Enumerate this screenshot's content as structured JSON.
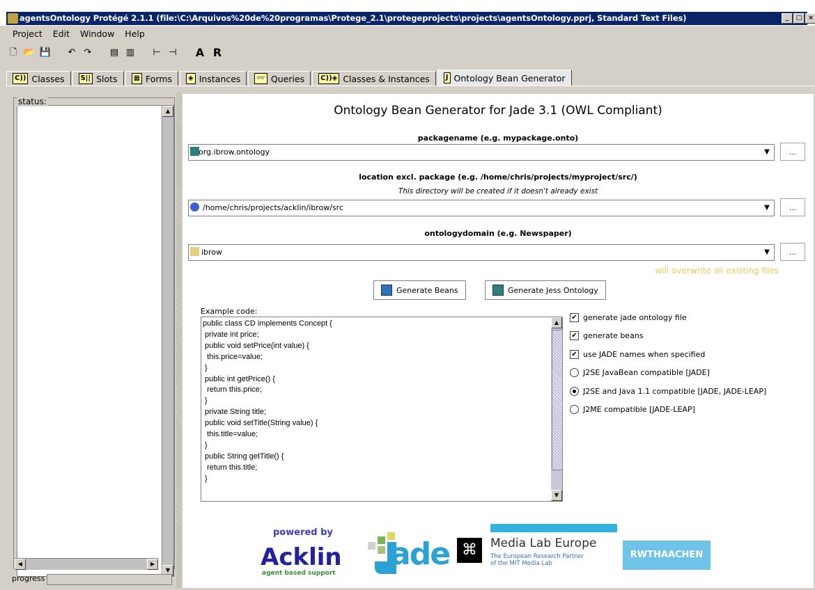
{
  "window": {
    "title": "agentsOntology  Protégé 2.1.1    (file:\\C:\\Arquivos%20de%20programas\\Protege_2.1\\protegeprojects\\projects\\agentsOntology.pprj, Standard Text Files)",
    "minimize": "_",
    "maximize": "□",
    "close": "×"
  },
  "menu": [
    "Project",
    "Edit",
    "Window",
    "Help"
  ],
  "toolbar": {
    "text_a": "A",
    "text_r": "R"
  },
  "tabs": [
    {
      "icon": "C))",
      "label": "Classes"
    },
    {
      "icon": "S||",
      "label": "Slots"
    },
    {
      "icon": "▦",
      "label": "Forms"
    },
    {
      "icon": "◈",
      "label": "Instances"
    },
    {
      "icon": "👓",
      "label": "Queries"
    },
    {
      "icon": "C))◈",
      "label": "Classes & Instances"
    },
    {
      "icon": "J",
      "label": "Ontology Bean Generator"
    }
  ],
  "left": {
    "status_label": "status:",
    "progress_label": "progress"
  },
  "main": {
    "heading": "Ontology Bean Generator for Jade 3.1 (OWL Compliant)",
    "package_label": "packagename (e.g. mypackage.onto)",
    "package_value": "org.ibrow.ontology",
    "location_label": "location excl. package (e.g. /home/chris/projects/myproject/src/)",
    "location_note": "This directory will be created if it doesn't already exist",
    "location_value": "/home/chris/projects/acklin/ibrow/src",
    "domain_label": "ontologydomain (e.g. Newspaper)",
    "domain_value": "ibrow",
    "browse_label": "...",
    "overwrite_warning": "will overwrite all existing files",
    "generate_beans": "Generate Beans",
    "generate_jess": "Generate Jess Ontology",
    "code_label": "Example code:",
    "code": "public class CD implements Concept {\n private int price;\n public void setPrice(int value) {\n  this.price=value;\n }\n public int getPrice() {\n  return this.price;\n }\n private String title;\n public void setTitle(String value) {\n  this.title=value;\n }\n public String getTitle() {\n  return this.title;\n }"
  },
  "options": [
    {
      "type": "checkbox",
      "label": "generate jade ontology file",
      "checked": true
    },
    {
      "type": "checkbox",
      "label": "generate beans",
      "checked": true
    },
    {
      "type": "checkbox",
      "label": "use JADE names when specified",
      "checked": true
    },
    {
      "type": "radio",
      "label": "J2SE JavaBean compatible [JADE]",
      "checked": false
    },
    {
      "type": "radio",
      "label": "J2SE and Java 1.1 compatible [JADE, JADE-LEAP]",
      "checked": true
    },
    {
      "type": "radio",
      "label": "J2ME compatible [JADE-LEAP]",
      "checked": false
    }
  ],
  "logos": {
    "powered_by": "powered by",
    "acklin": "Acklin",
    "acklin_sub": "agent based support",
    "jade": "ade",
    "mle_name": "Media Lab Europe",
    "mle_sub1": "The European Research Partner",
    "mle_sub2": "of the MIT Media Lab",
    "rwth": "RWTHAACHEN"
  },
  "colors": {
    "titlebar": "#0a246a",
    "warning": "#e8c860",
    "acklin": "#2020a0",
    "jade": "#2aa2d4"
  }
}
